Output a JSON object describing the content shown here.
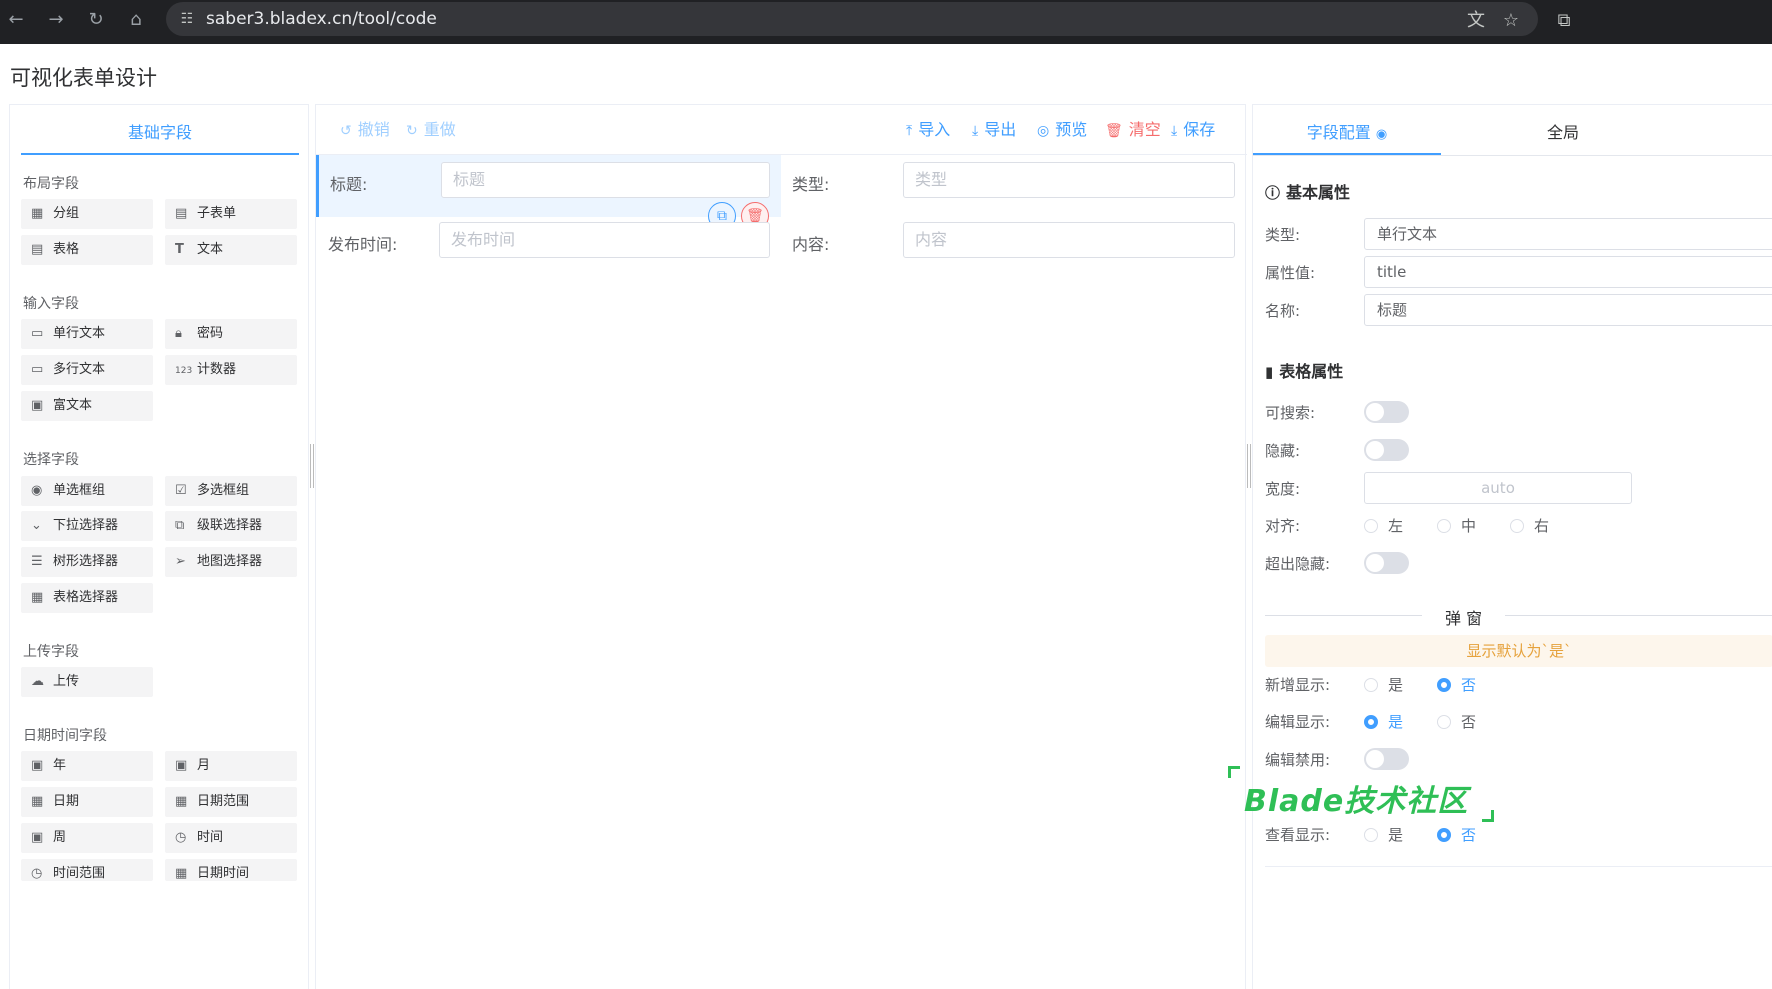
{
  "browser": {
    "url": "saber3.bladex.cn/tool/code",
    "icons": [
      "back-arrow-icon",
      "forward-arrow-icon",
      "reload-icon",
      "home-icon",
      "site-settings-icon",
      "translate-icon",
      "bookmark-star-icon",
      "extensions-icon"
    ]
  },
  "page": {
    "title": "可视化表单设计"
  },
  "left": {
    "tab": "基础字段",
    "groups": {
      "layout": "布局字段",
      "input": "输入字段",
      "select": "选择字段",
      "upload": "上传字段",
      "datetime": "日期时间字段"
    },
    "fields": {
      "group": "分组",
      "subform": "子表单",
      "table": "表格",
      "text": "文本",
      "single_text": "单行文本",
      "password": "密码",
      "multi_text": "多行文本",
      "counter": "计数器",
      "rich_text": "富文本",
      "radio_group": "单选框组",
      "checkbox_group": "多选框组",
      "dropdown": "下拉选择器",
      "cascader": "级联选择器",
      "tree_select": "树形选择器",
      "map_select": "地图选择器",
      "table_select": "表格选择器",
      "upload": "上传",
      "year": "年",
      "month": "月",
      "date": "日期",
      "date_range": "日期范围",
      "week": "周",
      "time": "时间",
      "time_range": "时间范围",
      "datetime": "日期时间"
    }
  },
  "toolbar": {
    "undo": "撤销",
    "redo": "重做",
    "import": "导入",
    "export": "导出",
    "preview": "预览",
    "clear": "清空",
    "save": "保存"
  },
  "canvas": {
    "title_label": "标题:",
    "title_placeholder": "标题",
    "type_label": "类型:",
    "type_placeholder": "类型",
    "publish_label": "发布时间:",
    "publish_placeholder": "发布时间",
    "content_label": "内容:",
    "content_placeholder": "内容"
  },
  "right": {
    "tab_field_config": "字段配置",
    "tab_global": "全局",
    "basic_section": "基本属性",
    "type_label": "类型:",
    "type_value": "单行文本",
    "prop_label": "属性值:",
    "prop_value": "title",
    "name_label": "名称:",
    "name_value": "标题",
    "table_section": "表格属性",
    "searchable_label": "可搜索:",
    "searchable": false,
    "hidden_label": "隐藏:",
    "hidden": false,
    "width_label": "宽度:",
    "width_placeholder": "auto",
    "align_label": "对齐:",
    "align_options": [
      "左",
      "中",
      "右"
    ],
    "overflow_label": "超出隐藏:",
    "overflow": false,
    "dialog_divider": "弹 窗",
    "dialog_notice": "显示默认为`是`",
    "add_show_label": "新增显示:",
    "add_show": "否",
    "edit_show_label": "编辑显示:",
    "edit_show": "是",
    "edit_disabled_label": "编辑禁用:",
    "edit_disabled": false,
    "view_show_label": "查看显示:",
    "view_show": "否",
    "yes": "是",
    "no": "否"
  },
  "watermark": "Blade技术社区",
  "colors": {
    "primary": "#409eff",
    "danger": "#f56c6c",
    "warning": "#e6a23c",
    "browser_bar": "#202124",
    "watermark": "#2fbf56"
  }
}
